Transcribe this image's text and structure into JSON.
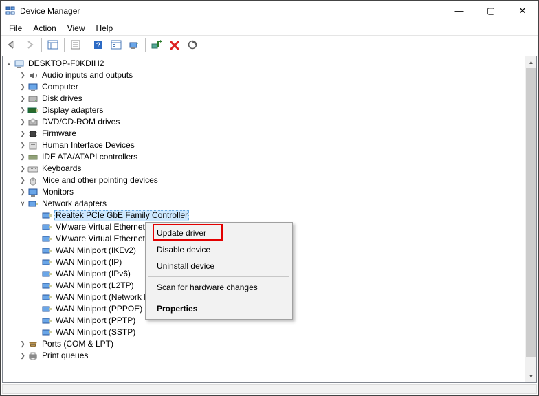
{
  "window": {
    "title": "Device Manager",
    "controls": {
      "min": "—",
      "max": "▢",
      "close": "✕"
    }
  },
  "menu": {
    "file": "File",
    "action": "Action",
    "view": "View",
    "help": "Help"
  },
  "tree": {
    "root": "DESKTOP-F0KDIH2",
    "cats": {
      "audio": "Audio inputs and outputs",
      "computer": "Computer",
      "disk": "Disk drives",
      "display": "Display adapters",
      "dvd": "DVD/CD-ROM drives",
      "firmware": "Firmware",
      "hid": "Human Interface Devices",
      "ide": "IDE ATA/ATAPI controllers",
      "keyboards": "Keyboards",
      "mice": "Mice and other pointing devices",
      "monitors": "Monitors",
      "network": "Network adapters",
      "ports": "Ports (COM & LPT)",
      "print": "Print queues"
    },
    "net": {
      "realtek": "Realtek PCIe GbE Family Controller",
      "vmware1": "VMware Virtual Ethernet",
      "vmware2": "VMware Virtual Ethernet",
      "ikev2": "WAN Miniport (IKEv2)",
      "ip": "WAN Miniport (IP)",
      "ipv6": "WAN Miniport (IPv6)",
      "l2tp": "WAN Miniport (L2TP)",
      "netmon": "WAN Miniport (Network Monitor)",
      "pppoe": "WAN Miniport (PPPOE)",
      "pptp": "WAN Miniport (PPTP)",
      "sstp": "WAN Miniport (SSTP)"
    }
  },
  "ctx": {
    "update": "Update driver",
    "disable": "Disable device",
    "uninstall": "Uninstall device",
    "scan": "Scan for hardware changes",
    "properties": "Properties"
  }
}
